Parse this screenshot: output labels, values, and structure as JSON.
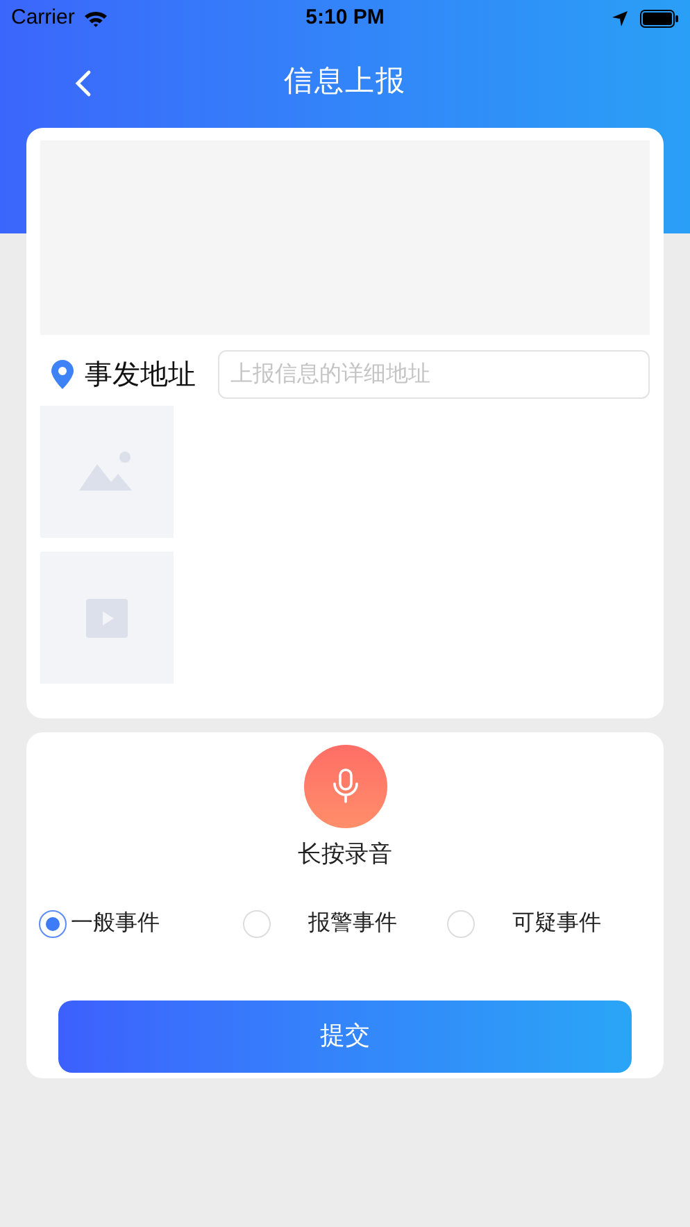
{
  "status_bar": {
    "carrier": "Carrier",
    "time": "5:10 PM"
  },
  "nav": {
    "title": "信息上报"
  },
  "report": {
    "address_label": "事发地址",
    "address_placeholder": "上报信息的详细地址",
    "attachments": [
      {
        "kind": "image"
      },
      {
        "kind": "video"
      }
    ]
  },
  "record": {
    "label": "长按录音"
  },
  "event_types": [
    {
      "label": "一般事件",
      "selected": true
    },
    {
      "label": "报警事件",
      "selected": false
    },
    {
      "label": "可疑事件",
      "selected": false
    }
  ],
  "submit": {
    "label": "提交"
  }
}
